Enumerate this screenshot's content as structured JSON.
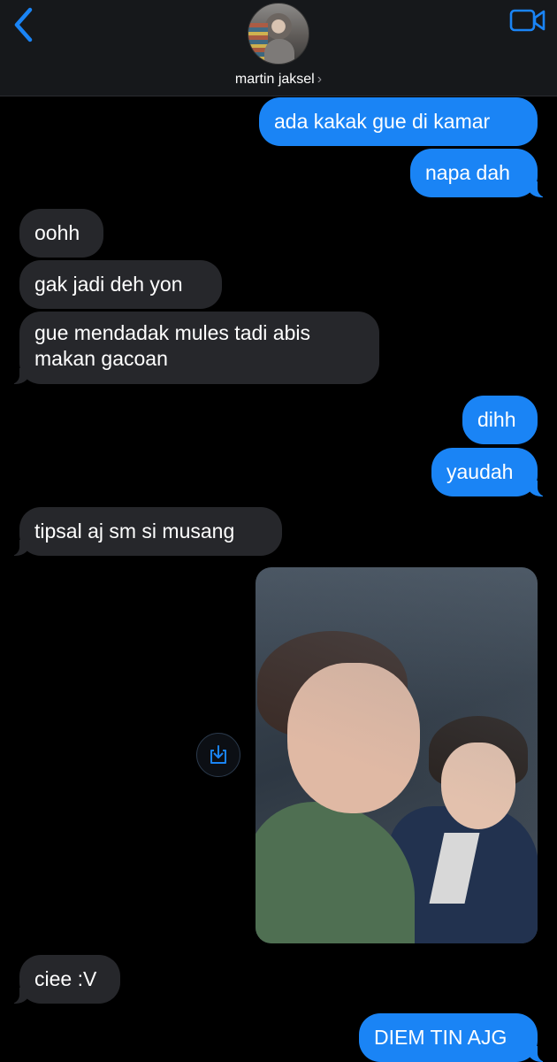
{
  "header": {
    "contact_name": "martin jaksel",
    "chevron": "›"
  },
  "messages": [
    {
      "id": "m1",
      "direction": "outgoing",
      "text": "ada kakak gue di kamar"
    },
    {
      "id": "m2",
      "direction": "outgoing",
      "text": "napa dah"
    },
    {
      "id": "m3",
      "direction": "incoming",
      "text": "oohh"
    },
    {
      "id": "m4",
      "direction": "incoming",
      "text": "gak jadi deh yon"
    },
    {
      "id": "m5",
      "direction": "incoming",
      "text": "gue mendadak mules tadi abis makan gacoan"
    },
    {
      "id": "m6",
      "direction": "outgoing",
      "text": "dihh"
    },
    {
      "id": "m7",
      "direction": "outgoing",
      "text": "yaudah"
    },
    {
      "id": "m8",
      "direction": "incoming",
      "text": "tipsal aj sm si musang"
    },
    {
      "id": "m9",
      "direction": "outgoing",
      "type": "photo"
    },
    {
      "id": "m10",
      "direction": "incoming",
      "text": "ciee :V"
    },
    {
      "id": "m11",
      "direction": "outgoing",
      "text": "DIEM TIN AJG"
    }
  ],
  "icons": {
    "back": "chevron-left-icon",
    "video": "video-camera-icon",
    "download": "download-icon"
  },
  "colors": {
    "accent": "#1a84f5",
    "incoming_bubble": "#26272b",
    "background": "#000000",
    "header_background": "#16181b"
  }
}
